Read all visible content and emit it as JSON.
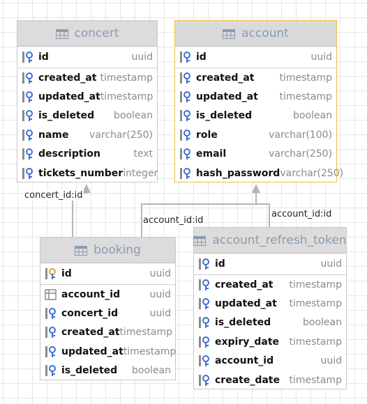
{
  "tables": [
    {
      "id": "concert",
      "name": "concert",
      "selected": false,
      "fields": [
        {
          "name": "id",
          "type": "uuid",
          "icon": "key-icon"
        },
        {
          "name": "created_at",
          "type": "timestamp",
          "icon": "column-icon"
        },
        {
          "name": "updated_at",
          "type": "timestamp",
          "icon": "column-icon"
        },
        {
          "name": "is_deleted",
          "type": "boolean",
          "icon": "column-icon"
        },
        {
          "name": "name",
          "type": "varchar(250)",
          "icon": "column-icon"
        },
        {
          "name": "description",
          "type": "text",
          "icon": "column-icon"
        },
        {
          "name": "tickets_number",
          "type": "integer",
          "icon": "column-icon"
        }
      ]
    },
    {
      "id": "account",
      "name": "account",
      "selected": true,
      "fields": [
        {
          "name": "id",
          "type": "uuid",
          "icon": "key-icon"
        },
        {
          "name": "created_at",
          "type": "timestamp",
          "icon": "column-icon"
        },
        {
          "name": "updated_at",
          "type": "timestamp",
          "icon": "column-icon"
        },
        {
          "name": "is_deleted",
          "type": "boolean",
          "icon": "column-icon"
        },
        {
          "name": "role",
          "type": "varchar(100)",
          "icon": "column-icon"
        },
        {
          "name": "email",
          "type": "varchar(250)",
          "icon": "column-icon"
        },
        {
          "name": "hash_password",
          "type": "varchar(250)",
          "icon": "column-icon"
        }
      ]
    },
    {
      "id": "booking",
      "name": "booking",
      "selected": false,
      "fields": [
        {
          "name": "id",
          "type": "uuid",
          "icon": "primary-key-icon"
        },
        {
          "name": "account_id",
          "type": "uuid",
          "icon": "foreign-key-icon"
        },
        {
          "name": "concert_id",
          "type": "uuid",
          "icon": "column-icon"
        },
        {
          "name": "created_at",
          "type": "timestamp",
          "icon": "column-icon"
        },
        {
          "name": "updated_at",
          "type": "timestamp",
          "icon": "column-icon"
        },
        {
          "name": "is_deleted",
          "type": "boolean",
          "icon": "column-icon"
        }
      ]
    },
    {
      "id": "account_refresh_token",
      "name": "account_refresh_token",
      "selected": false,
      "fields": [
        {
          "name": "id",
          "type": "uuid",
          "icon": "key-icon"
        },
        {
          "name": "created_at",
          "type": "timestamp",
          "icon": "column-icon"
        },
        {
          "name": "updated_at",
          "type": "timestamp",
          "icon": "column-icon"
        },
        {
          "name": "is_deleted",
          "type": "boolean",
          "icon": "column-icon"
        },
        {
          "name": "expiry_date",
          "type": "timestamp",
          "icon": "column-icon"
        },
        {
          "name": "account_id",
          "type": "uuid",
          "icon": "column-icon"
        },
        {
          "name": "create_date",
          "type": "timestamp",
          "icon": "column-icon"
        }
      ]
    }
  ],
  "links": [
    {
      "label": "concert_id:id",
      "from": "booking",
      "to": "concert"
    },
    {
      "label": "account_id:id",
      "from": "booking",
      "to": "account"
    },
    {
      "label": "account_id:id",
      "from": "account_refresh_token",
      "to": "account"
    }
  ],
  "colors": {
    "selected_border": "#f0c040",
    "header_bg": "#dcdcdc",
    "header_text": "#8a9bb0",
    "key_icon": "#3a6fd8",
    "link_line": "#b5b5b5"
  }
}
